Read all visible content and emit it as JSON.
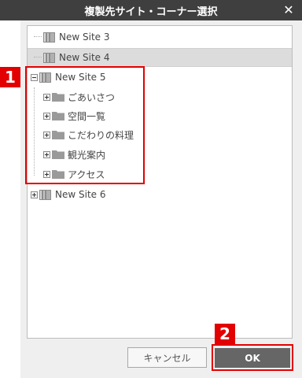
{
  "dialog": {
    "title": "複製先サイト・コーナー選択",
    "close_glyph": "✕"
  },
  "tree": {
    "sites": [
      {
        "label": "New Site 3",
        "selected": false,
        "expanded": false
      },
      {
        "label": "New Site 4",
        "selected": true,
        "expanded": false
      },
      {
        "label": "New Site 5",
        "selected": false,
        "expanded": true,
        "children": [
          "ごあいさつ",
          "空間一覧",
          "こだわりの料理",
          "観光案内",
          "アクセス"
        ]
      },
      {
        "label": "New Site 6",
        "selected": false,
        "expanded": false
      }
    ]
  },
  "callouts": {
    "step1": "1",
    "step2": "2",
    "color": "#e20000"
  },
  "buttons": {
    "cancel": "キャンセル",
    "ok": "OK"
  },
  "icons": {
    "site": "site-pages-icon",
    "folder": "folder-icon",
    "expand": "plus-box-icon",
    "collapse": "minus-box-icon",
    "close": "close-icon"
  }
}
